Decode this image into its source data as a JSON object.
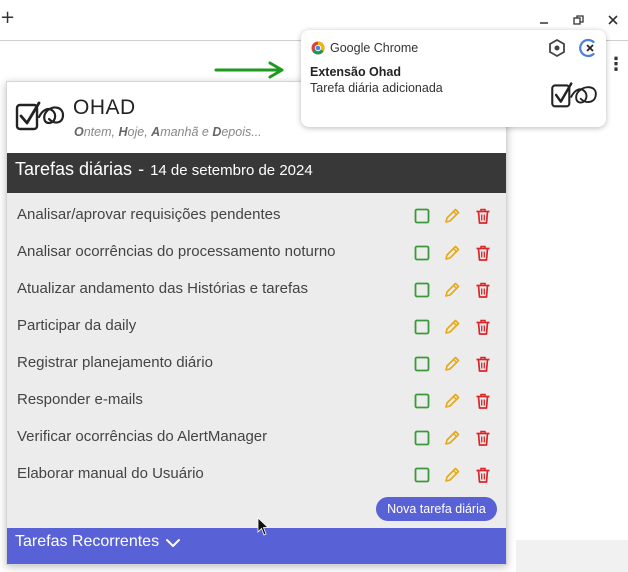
{
  "browser": {
    "new_tab_glyph": "+",
    "window_controls": [
      "minimize-icon",
      "restore-icon",
      "close-icon"
    ],
    "menu_glyph": "⋮"
  },
  "popup": {
    "app_name": "OHAD",
    "tagline": [
      {
        "bold": "O",
        "rest": "ntem, "
      },
      {
        "bold": "H",
        "rest": "oje, "
      },
      {
        "bold": "A",
        "rest": "manhã e "
      },
      {
        "bold": "D",
        "rest": "epois..."
      }
    ],
    "daily_header": {
      "title": "Tarefas diárias",
      "separator": "-",
      "date": "14 de setembro de 2024"
    },
    "tasks": [
      {
        "label": "Analisar/aprovar requisições pendentes"
      },
      {
        "label": "Analisar ocorrências do processamento noturno"
      },
      {
        "label": "Atualizar andamento das Histórias e tarefas"
      },
      {
        "label": "Participar da daily"
      },
      {
        "label": "Registrar planejamento diário"
      },
      {
        "label": "Responder e-mails"
      },
      {
        "label": "Verificar ocorrências do AlertManager"
      },
      {
        "label": "Elaborar manual do Usuário"
      }
    ],
    "new_task_button": "Nova tarefa diária",
    "recurring_header": "Tarefas Recorrentes"
  },
  "notification": {
    "app": "Google Chrome",
    "title": "Extensão Ohad",
    "message": "Tarefa diária adicionada"
  },
  "colors": {
    "accent": "#5961d6",
    "header_dark": "#383838",
    "check_green": "#3a9a3a",
    "edit_yellow": "#e6a817",
    "delete_red": "#d9262a",
    "arrow_green": "#1e9a1e"
  }
}
